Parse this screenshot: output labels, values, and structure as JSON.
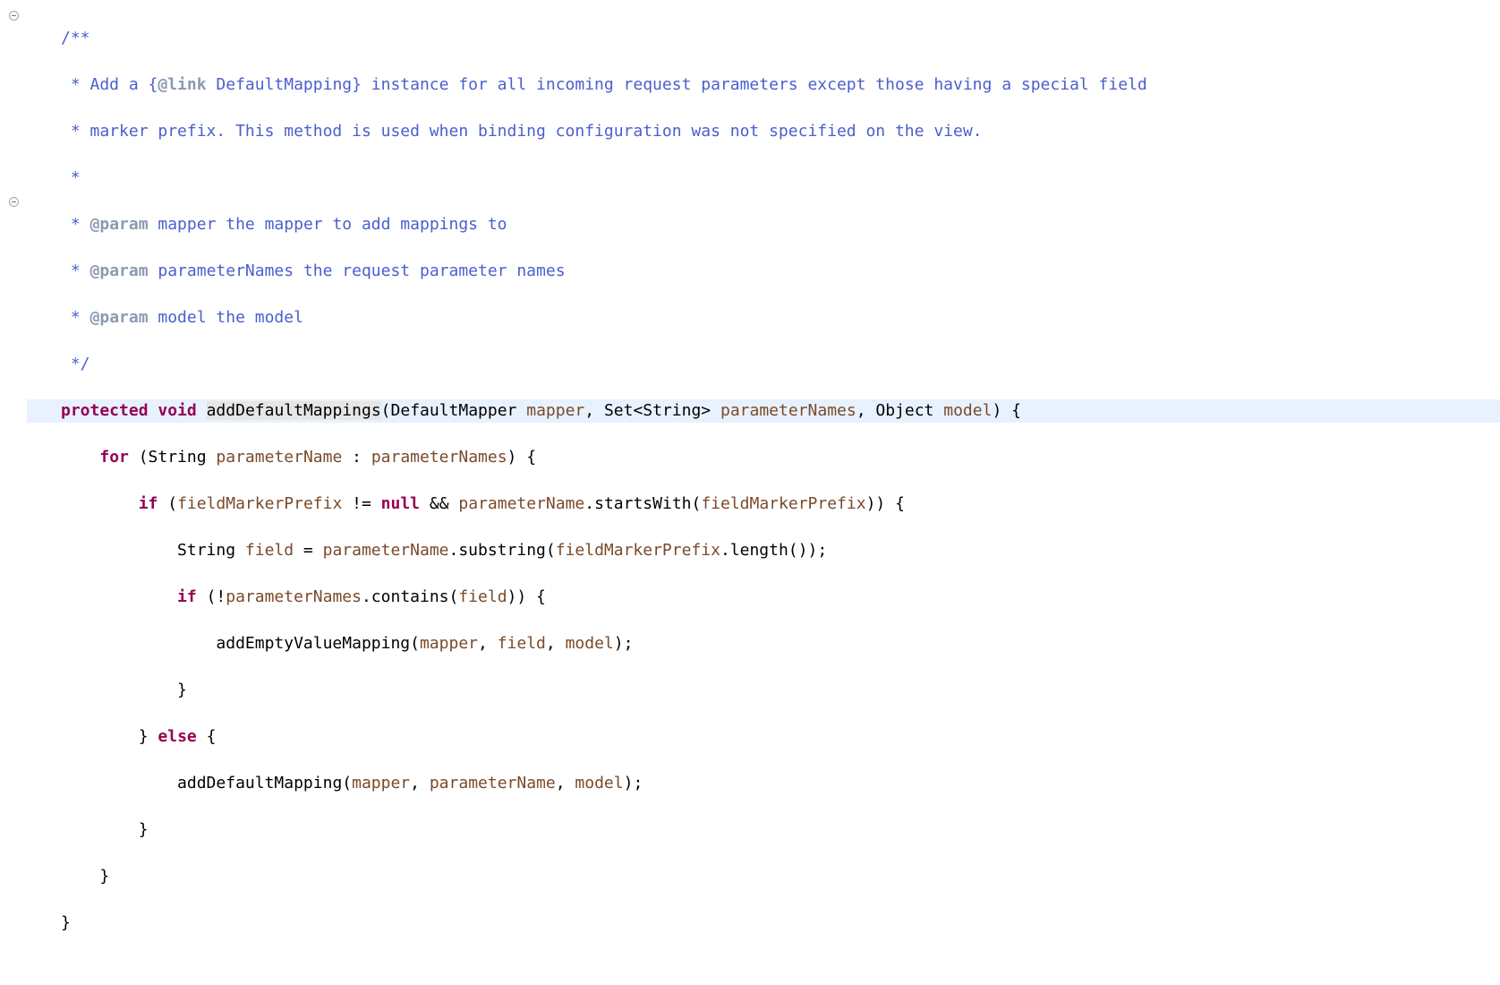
{
  "gutter": {
    "fold_icon": "collapse"
  },
  "code": {
    "javadoc": {
      "open": "/**",
      "l1_pre": " * Add a {",
      "l1_tag": "@link",
      "l1_post": " DefaultMapping} instance for all incoming request parameters except those having a special field",
      "l2": " * marker prefix. This method is used when binding configuration was not specified on the view.",
      "l3": " * ",
      "l4_tag": "@param",
      "l4_text": " mapper the mapper to add mappings to",
      "l5_tag": "@param",
      "l5_text": " parameterNames the request parameter names",
      "l6_tag": "@param",
      "l6_text": " model the model",
      "close": " */"
    },
    "sig": {
      "kw1": "protected",
      "kw2": "void",
      "name": "addDefaultMappings",
      "p_open": "(",
      "t1": "DefaultMapper ",
      "a1": "mapper",
      "c1": ", Set<String> ",
      "a2": "parameterNames",
      "c2": ", Object ",
      "a3": "model",
      "p_close": ") {"
    },
    "body": {
      "for_kw": "for",
      "for_rest1": " (String ",
      "for_var": "parameterName",
      "for_rest2": " : ",
      "for_iter": "parameterNames",
      "for_rest3": ") {",
      "if1_kw": "if",
      "if1_a": " (",
      "if1_b": "fieldMarkerPrefix",
      "if1_c": " != ",
      "if1_null": "null",
      "if1_d": " && ",
      "if1_e": "parameterName",
      "if1_f": ".startsWith(",
      "if1_g": "fieldMarkerPrefix",
      "if1_h": ")) {",
      "s1_a": "String ",
      "s1_b": "field",
      "s1_c": " = ",
      "s1_d": "parameterName",
      "s1_e": ".substring(",
      "s1_f": "fieldMarkerPrefix",
      "s1_g": ".length());",
      "if2_kw": "if",
      "if2_a": " (!",
      "if2_b": "parameterNames",
      "if2_c": ".contains(",
      "if2_d": "field",
      "if2_e": ")) {",
      "call1_a": "addEmptyValueMapping(",
      "call1_b": "mapper",
      "call1_c": ", ",
      "call1_d": "field",
      "call1_e": ", ",
      "call1_f": "model",
      "call1_g": ");",
      "brace_close1": "}",
      "else_a": "} ",
      "else_kw": "else",
      "else_b": " {",
      "call2_a": "addDefaultMapping(",
      "call2_b": "mapper",
      "call2_c": ", ",
      "call2_d": "parameterName",
      "call2_e": ", ",
      "call2_f": "model",
      "call2_g": ");",
      "brace_close2": "}",
      "brace_close3": "}",
      "brace_close4": "}"
    }
  }
}
